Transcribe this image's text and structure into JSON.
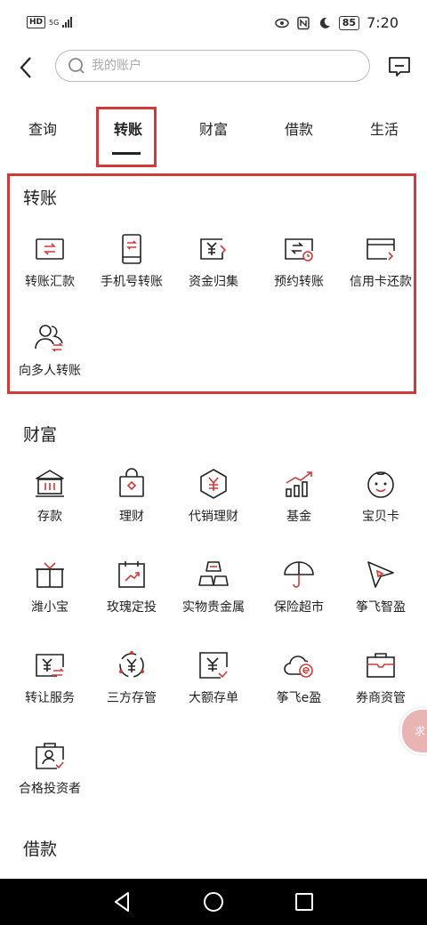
{
  "status_bar": {
    "network": "HD",
    "signal_label": "5G",
    "battery": "85",
    "time": "7:20"
  },
  "search": {
    "placeholder": "我的账户"
  },
  "tabs": [
    {
      "label": "查询"
    },
    {
      "label": "转账"
    },
    {
      "label": "财富"
    },
    {
      "label": "借款"
    },
    {
      "label": "生活"
    }
  ],
  "active_tab": "转账",
  "sections": {
    "transfer": {
      "title": "转账",
      "items": [
        {
          "label": "转账汇款",
          "icon": "transfer-card-icon"
        },
        {
          "label": "手机号转账",
          "icon": "phone-transfer-icon"
        },
        {
          "label": "资金归集",
          "icon": "fund-collect-icon"
        },
        {
          "label": "预约转账",
          "icon": "scheduled-transfer-icon"
        },
        {
          "label": "信用卡还款",
          "icon": "credit-card-icon"
        },
        {
          "label": "向多人转账",
          "icon": "multi-person-icon"
        }
      ]
    },
    "wealth": {
      "title": "财富",
      "items": [
        {
          "label": "存款",
          "icon": "bank-icon"
        },
        {
          "label": "理财",
          "icon": "bag-icon"
        },
        {
          "label": "代销理财",
          "icon": "hexagon-yuan-icon"
        },
        {
          "label": "基金",
          "icon": "bar-chart-icon"
        },
        {
          "label": "宝贝卡",
          "icon": "baby-face-icon"
        },
        {
          "label": "潍小宝",
          "icon": "gift-box-icon"
        },
        {
          "label": "玫瑰定投",
          "icon": "calendar-chart-icon"
        },
        {
          "label": "实物贵金属",
          "icon": "gold-bars-icon"
        },
        {
          "label": "保险超市",
          "icon": "umbrella-icon"
        },
        {
          "label": "筝飞智盈",
          "icon": "kite-icon"
        },
        {
          "label": "转让服务",
          "icon": "yuan-transfer-icon"
        },
        {
          "label": "三方存管",
          "icon": "yuan-cycle-icon"
        },
        {
          "label": "大额存单",
          "icon": "large-deposit-icon"
        },
        {
          "label": "筝飞e盈",
          "icon": "cloud-e-icon"
        },
        {
          "label": "券商资管",
          "icon": "briefcase-icon"
        },
        {
          "label": "合格投资者",
          "icon": "investor-icon"
        }
      ]
    },
    "loan": {
      "title": "借款"
    }
  },
  "float_button": {
    "label": "求"
  },
  "colors": {
    "accent": "#d23a3a",
    "icon_stroke": "#222222"
  }
}
